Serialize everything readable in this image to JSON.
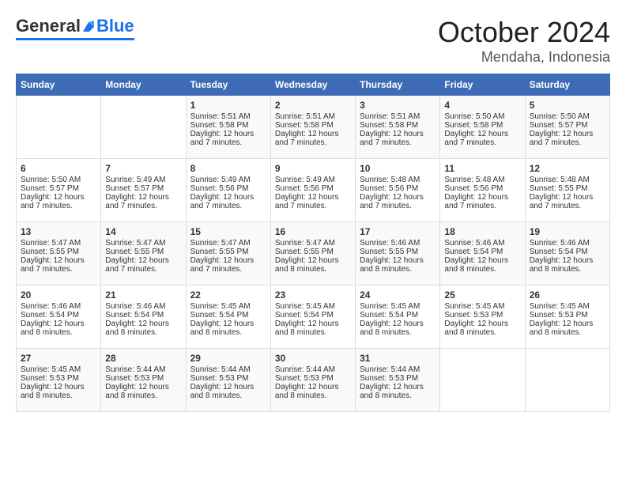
{
  "header": {
    "logo_general": "General",
    "logo_blue": "Blue",
    "title": "October 2024",
    "subtitle": "Mendaha, Indonesia"
  },
  "days_of_week": [
    "Sunday",
    "Monday",
    "Tuesday",
    "Wednesday",
    "Thursday",
    "Friday",
    "Saturday"
  ],
  "weeks": [
    [
      {
        "day": "",
        "info": ""
      },
      {
        "day": "",
        "info": ""
      },
      {
        "day": "1",
        "info": "Sunrise: 5:51 AM\nSunset: 5:58 PM\nDaylight: 12 hours\nand 7 minutes."
      },
      {
        "day": "2",
        "info": "Sunrise: 5:51 AM\nSunset: 5:58 PM\nDaylight: 12 hours\nand 7 minutes."
      },
      {
        "day": "3",
        "info": "Sunrise: 5:51 AM\nSunset: 5:58 PM\nDaylight: 12 hours\nand 7 minutes."
      },
      {
        "day": "4",
        "info": "Sunrise: 5:50 AM\nSunset: 5:58 PM\nDaylight: 12 hours\nand 7 minutes."
      },
      {
        "day": "5",
        "info": "Sunrise: 5:50 AM\nSunset: 5:57 PM\nDaylight: 12 hours\nand 7 minutes."
      }
    ],
    [
      {
        "day": "6",
        "info": "Sunrise: 5:50 AM\nSunset: 5:57 PM\nDaylight: 12 hours\nand 7 minutes."
      },
      {
        "day": "7",
        "info": "Sunrise: 5:49 AM\nSunset: 5:57 PM\nDaylight: 12 hours\nand 7 minutes."
      },
      {
        "day": "8",
        "info": "Sunrise: 5:49 AM\nSunset: 5:56 PM\nDaylight: 12 hours\nand 7 minutes."
      },
      {
        "day": "9",
        "info": "Sunrise: 5:49 AM\nSunset: 5:56 PM\nDaylight: 12 hours\nand 7 minutes."
      },
      {
        "day": "10",
        "info": "Sunrise: 5:48 AM\nSunset: 5:56 PM\nDaylight: 12 hours\nand 7 minutes."
      },
      {
        "day": "11",
        "info": "Sunrise: 5:48 AM\nSunset: 5:56 PM\nDaylight: 12 hours\nand 7 minutes."
      },
      {
        "day": "12",
        "info": "Sunrise: 5:48 AM\nSunset: 5:55 PM\nDaylight: 12 hours\nand 7 minutes."
      }
    ],
    [
      {
        "day": "13",
        "info": "Sunrise: 5:47 AM\nSunset: 5:55 PM\nDaylight: 12 hours\nand 7 minutes."
      },
      {
        "day": "14",
        "info": "Sunrise: 5:47 AM\nSunset: 5:55 PM\nDaylight: 12 hours\nand 7 minutes."
      },
      {
        "day": "15",
        "info": "Sunrise: 5:47 AM\nSunset: 5:55 PM\nDaylight: 12 hours\nand 7 minutes."
      },
      {
        "day": "16",
        "info": "Sunrise: 5:47 AM\nSunset: 5:55 PM\nDaylight: 12 hours\nand 8 minutes."
      },
      {
        "day": "17",
        "info": "Sunrise: 5:46 AM\nSunset: 5:55 PM\nDaylight: 12 hours\nand 8 minutes."
      },
      {
        "day": "18",
        "info": "Sunrise: 5:46 AM\nSunset: 5:54 PM\nDaylight: 12 hours\nand 8 minutes."
      },
      {
        "day": "19",
        "info": "Sunrise: 5:46 AM\nSunset: 5:54 PM\nDaylight: 12 hours\nand 8 minutes."
      }
    ],
    [
      {
        "day": "20",
        "info": "Sunrise: 5:46 AM\nSunset: 5:54 PM\nDaylight: 12 hours\nand 8 minutes."
      },
      {
        "day": "21",
        "info": "Sunrise: 5:46 AM\nSunset: 5:54 PM\nDaylight: 12 hours\nand 8 minutes."
      },
      {
        "day": "22",
        "info": "Sunrise: 5:45 AM\nSunset: 5:54 PM\nDaylight: 12 hours\nand 8 minutes."
      },
      {
        "day": "23",
        "info": "Sunrise: 5:45 AM\nSunset: 5:54 PM\nDaylight: 12 hours\nand 8 minutes."
      },
      {
        "day": "24",
        "info": "Sunrise: 5:45 AM\nSunset: 5:54 PM\nDaylight: 12 hours\nand 8 minutes."
      },
      {
        "day": "25",
        "info": "Sunrise: 5:45 AM\nSunset: 5:53 PM\nDaylight: 12 hours\nand 8 minutes."
      },
      {
        "day": "26",
        "info": "Sunrise: 5:45 AM\nSunset: 5:53 PM\nDaylight: 12 hours\nand 8 minutes."
      }
    ],
    [
      {
        "day": "27",
        "info": "Sunrise: 5:45 AM\nSunset: 5:53 PM\nDaylight: 12 hours\nand 8 minutes."
      },
      {
        "day": "28",
        "info": "Sunrise: 5:44 AM\nSunset: 5:53 PM\nDaylight: 12 hours\nand 8 minutes."
      },
      {
        "day": "29",
        "info": "Sunrise: 5:44 AM\nSunset: 5:53 PM\nDaylight: 12 hours\nand 8 minutes."
      },
      {
        "day": "30",
        "info": "Sunrise: 5:44 AM\nSunset: 5:53 PM\nDaylight: 12 hours\nand 8 minutes."
      },
      {
        "day": "31",
        "info": "Sunrise: 5:44 AM\nSunset: 5:53 PM\nDaylight: 12 hours\nand 8 minutes."
      },
      {
        "day": "",
        "info": ""
      },
      {
        "day": "",
        "info": ""
      }
    ]
  ]
}
